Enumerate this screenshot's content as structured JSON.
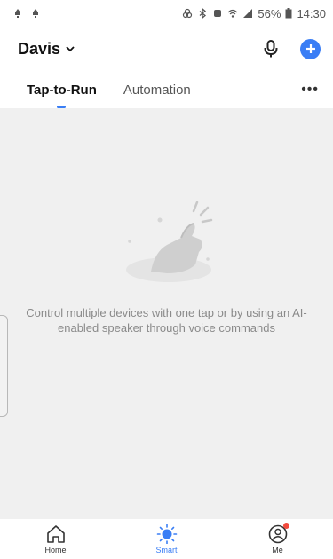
{
  "status_bar": {
    "battery": "56%",
    "time": "14:30"
  },
  "header": {
    "home_name": "Davis"
  },
  "tabs": [
    {
      "label": "Tap-to-Run",
      "active": true
    },
    {
      "label": "Automation",
      "active": false
    }
  ],
  "more_label": "•••",
  "empty_state": {
    "message": "Control multiple devices with one tap or by using an AI-enabled speaker through voice commands"
  },
  "bottom_nav": [
    {
      "label": "Home",
      "icon": "home-icon",
      "active": false
    },
    {
      "label": "Smart",
      "icon": "smart-icon",
      "active": true
    },
    {
      "label": "Me",
      "icon": "profile-icon",
      "active": false
    }
  ],
  "colors": {
    "accent": "#3a7ef5",
    "notification": "#f24a3d",
    "background": "#f0f0f0"
  }
}
